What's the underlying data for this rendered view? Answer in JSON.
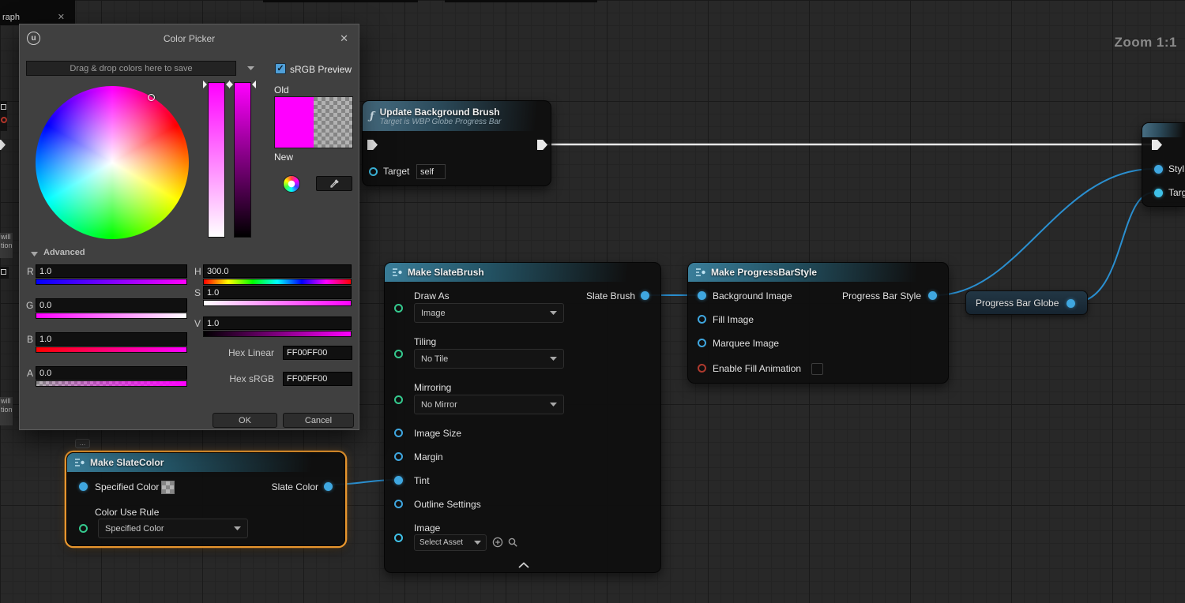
{
  "window": {
    "tab_label": "raph",
    "tab_close": "✕",
    "zoom_label": "Zoom 1:1"
  },
  "fragments": {
    "comment_line1": "will",
    "comment_line2": "tion"
  },
  "color_picker": {
    "title": "Color Picker",
    "close_icon": "✕",
    "drop_combo_placeholder": "Drag & drop colors here to save",
    "srgb_label": "sRGB Preview",
    "srgb_check": "✓",
    "old_label": "Old",
    "new_label": "New",
    "advanced_label": "Advanced",
    "rgba_rows": [
      {
        "label": "R",
        "value": "1.0"
      },
      {
        "label": "G",
        "value": "0.0"
      },
      {
        "label": "B",
        "value": "1.0"
      },
      {
        "label": "A",
        "value": "0.0"
      }
    ],
    "hsv_rows": [
      {
        "label": "H",
        "value": "300.0"
      },
      {
        "label": "S",
        "value": "1.0"
      },
      {
        "label": "V",
        "value": "1.0"
      }
    ],
    "hex_linear_label": "Hex Linear",
    "hex_linear_value": "FF00FF00",
    "hex_srgb_label": "Hex sRGB",
    "hex_srgb_value": "FF00FF00",
    "ok_label": "OK",
    "cancel_label": "Cancel"
  },
  "nodes": {
    "update_background_brush": {
      "title": "Update Background Brush",
      "subtitle": "Target is WBP Globe Progress Bar",
      "target_label": "Target",
      "target_value": "self"
    },
    "make_slate_brush": {
      "title": "Make SlateBrush",
      "draw_as_label": "Draw As",
      "draw_as_value": "Image",
      "slate_brush_label": "Slate Brush",
      "tiling_label": "Tiling",
      "tiling_value": "No Tile",
      "mirroring_label": "Mirroring",
      "mirroring_value": "No Mirror",
      "image_size_label": "Image Size",
      "margin_label": "Margin",
      "tint_label": "Tint",
      "outline_settings_label": "Outline Settings",
      "image_label": "Image",
      "image_value": "Select Asset"
    },
    "make_progress_bar_style": {
      "title": "Make ProgressBarStyle",
      "background_image_label": "Background Image",
      "progress_bar_style_label": "Progress Bar Style",
      "fill_image_label": "Fill Image",
      "marquee_image_label": "Marquee Image",
      "enable_fill_animation_label": "Enable Fill Animation"
    },
    "progress_bar_globe": {
      "title": "Progress Bar Globe"
    },
    "make_slate_color": {
      "title": "Make SlateColor",
      "specified_color_label": "Specified Color",
      "slate_color_label": "Slate Color",
      "color_use_rule_label": "Color Use Rule",
      "color_use_rule_value": "Specified Color",
      "comment_bubble": "..."
    },
    "clipped_right_node": {
      "pin1_label": "Styl",
      "pin2_label": "Targ"
    }
  },
  "colors": {
    "picked": "#ff00ff",
    "selection": "#e8962e",
    "wire-exec": "#e8e8e8",
    "wire-data": "#2a8fd0",
    "pin-struct": "#3fa7e0",
    "pin-object": "#3fc1e8",
    "pin-enum": "#35c98e",
    "pin-bool": "#b03a2e"
  }
}
